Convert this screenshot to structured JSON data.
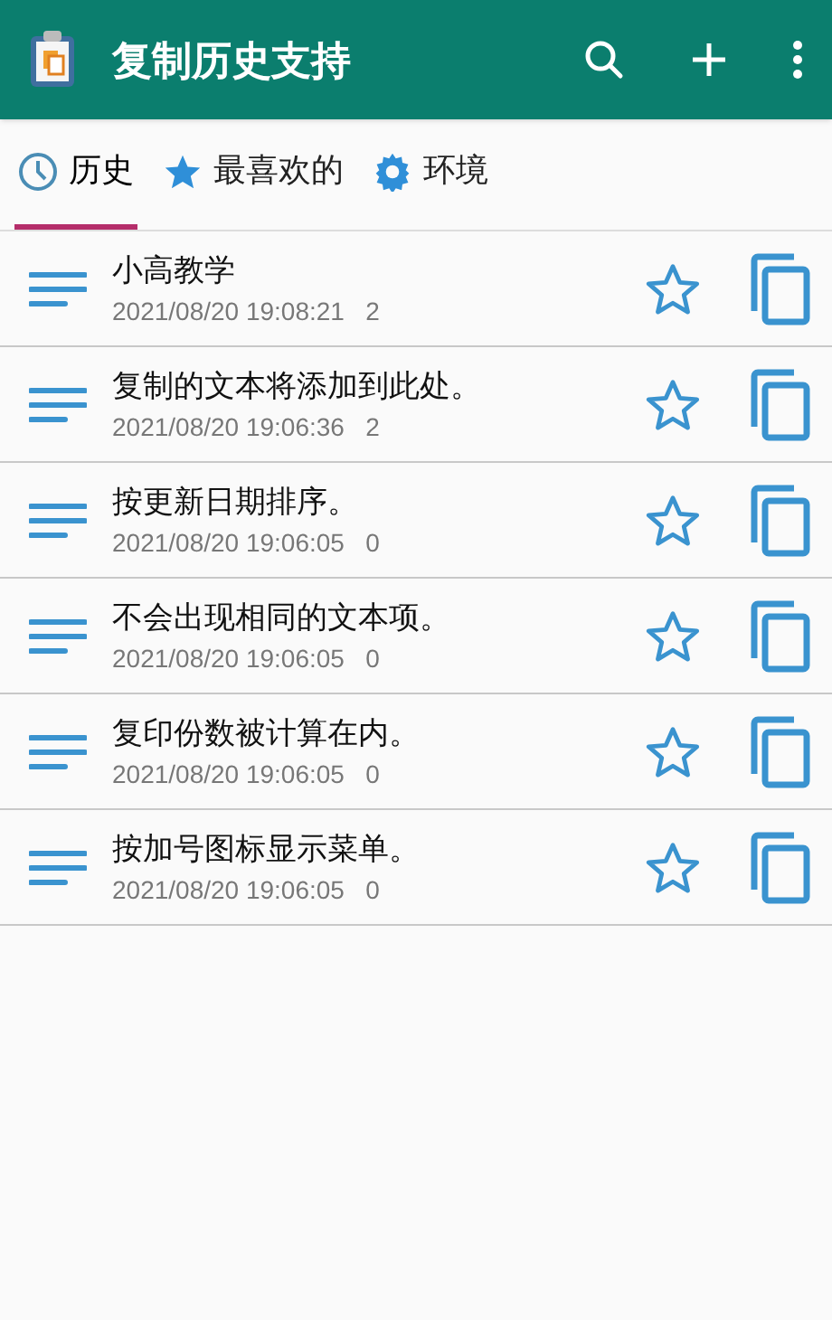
{
  "app_bar": {
    "title": "复制历史支持"
  },
  "tabs": [
    {
      "label": "历史",
      "kind": "clock",
      "selected": true
    },
    {
      "label": "最喜欢的",
      "kind": "star",
      "selected": false
    },
    {
      "label": "环境",
      "kind": "gear",
      "selected": false
    }
  ],
  "items": [
    {
      "text": "小高教学",
      "date": "2021/08/20 19:08:21",
      "count": "2",
      "favorite": false
    },
    {
      "text": "复制的文本将添加到此处。",
      "date": "2021/08/20 19:06:36",
      "count": "2",
      "favorite": false
    },
    {
      "text": "按更新日期排序。",
      "date": "2021/08/20 19:06:05",
      "count": "0",
      "favorite": false
    },
    {
      "text": "不会出现相同的文本项。",
      "date": "2021/08/20 19:06:05",
      "count": "0",
      "favorite": false
    },
    {
      "text": "复印份数被计算在内。",
      "date": "2021/08/20 19:06:05",
      "count": "0",
      "favorite": false
    },
    {
      "text": "按加号图标显示菜单。",
      "date": "2021/08/20 19:06:05",
      "count": "0",
      "favorite": false
    }
  ]
}
